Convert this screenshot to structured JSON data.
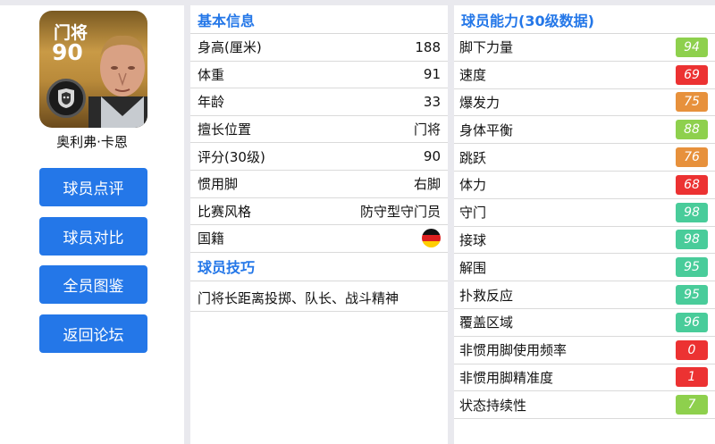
{
  "colors": {
    "accent": "#2477e8",
    "green": "#8ed04d",
    "red": "#ec3232",
    "orange": "#e7913c",
    "teal": "#49cc9a"
  },
  "card": {
    "position": "门将",
    "rating": "90",
    "club_badge": "club-crest-icon"
  },
  "player": {
    "name": "奥利弗·卡恩"
  },
  "nav": {
    "review": "球员点评",
    "compare": "球员对比",
    "catalog": "全员图鉴",
    "back": "返回论坛"
  },
  "basic": {
    "title": "基本信息",
    "rows": [
      {
        "label": "身高(厘米)",
        "value": "188"
      },
      {
        "label": "体重",
        "value": "91"
      },
      {
        "label": "年龄",
        "value": "33"
      },
      {
        "label": "擅长位置",
        "value": "门将"
      },
      {
        "label": "评分(30级)",
        "value": "90"
      },
      {
        "label": "惯用脚",
        "value": "右脚"
      },
      {
        "label": "比赛风格",
        "value": "防守型守门员"
      }
    ],
    "nationality_label": "国籍",
    "nationality_flag": "germany-flag-icon"
  },
  "skills": {
    "title": "球员技巧",
    "text": "门将长距离投掷、队长、战斗精神"
  },
  "abilities": {
    "title": "球员能力(30级数据)",
    "rows": [
      {
        "label": "脚下力量",
        "value": "94",
        "color": "#8ed04d"
      },
      {
        "label": "速度",
        "value": "69",
        "color": "#ec3232"
      },
      {
        "label": "爆发力",
        "value": "75",
        "color": "#e7913c"
      },
      {
        "label": "身体平衡",
        "value": "88",
        "color": "#8ed04d"
      },
      {
        "label": "跳跃",
        "value": "76",
        "color": "#e7913c"
      },
      {
        "label": "体力",
        "value": "68",
        "color": "#ec3232"
      },
      {
        "label": "守门",
        "value": "98",
        "color": "#49cc9a"
      },
      {
        "label": "接球",
        "value": "98",
        "color": "#49cc9a"
      },
      {
        "label": "解围",
        "value": "95",
        "color": "#49cc9a"
      },
      {
        "label": "扑救反应",
        "value": "95",
        "color": "#49cc9a"
      },
      {
        "label": "覆盖区域",
        "value": "96",
        "color": "#49cc9a"
      },
      {
        "label": "非惯用脚使用频率",
        "value": "0",
        "color": "#ec3232"
      },
      {
        "label": "非惯用脚精准度",
        "value": "1",
        "color": "#ec3232"
      },
      {
        "label": "状态持续性",
        "value": "7",
        "color": "#8ed04d"
      }
    ]
  }
}
